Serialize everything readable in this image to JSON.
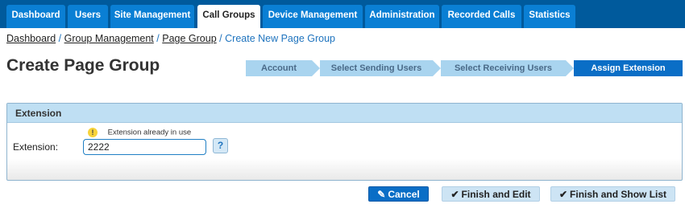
{
  "nav": {
    "tabs": [
      {
        "label": "Dashboard",
        "active": false
      },
      {
        "label": "Users",
        "active": false
      },
      {
        "label": "Site Management",
        "active": false
      },
      {
        "label": "Call Groups",
        "active": true
      },
      {
        "label": "Device Management",
        "active": false
      },
      {
        "label": "Administration",
        "active": false
      },
      {
        "label": "Recorded Calls",
        "active": false
      },
      {
        "label": "Statistics",
        "active": false
      }
    ]
  },
  "breadcrumb": {
    "items": [
      "Dashboard",
      "Group Management",
      "Page Group"
    ],
    "current": "Create New Page Group",
    "separator": "/"
  },
  "page": {
    "title": "Create Page Group"
  },
  "wizard": {
    "steps": [
      {
        "label": "Account",
        "active": false
      },
      {
        "label": "Select Sending Users",
        "active": false
      },
      {
        "label": "Select Receiving Users",
        "active": false
      },
      {
        "label": "Assign Extension",
        "active": true
      }
    ]
  },
  "panel": {
    "title": "Extension",
    "warning_icon": "warning-icon",
    "warning_glyph": "!",
    "warning": "Extension already in use",
    "field_label": "Extension:",
    "field_value": "2222",
    "help_label": "?"
  },
  "actions": {
    "cancel_icon": "cancel-icon",
    "cancel": "Cancel",
    "finish_icon": "checkmark-icon",
    "finish_edit": "Finish and Edit",
    "finish_list": "Finish and Show List"
  },
  "colors": {
    "nav_bar": "#005a9c",
    "tab": "#0a7fd4",
    "step_inactive": "#a9d4ef",
    "step_active": "#0a6ec6",
    "panel_header": "#bfdff3",
    "warning": "#f7d33a"
  }
}
